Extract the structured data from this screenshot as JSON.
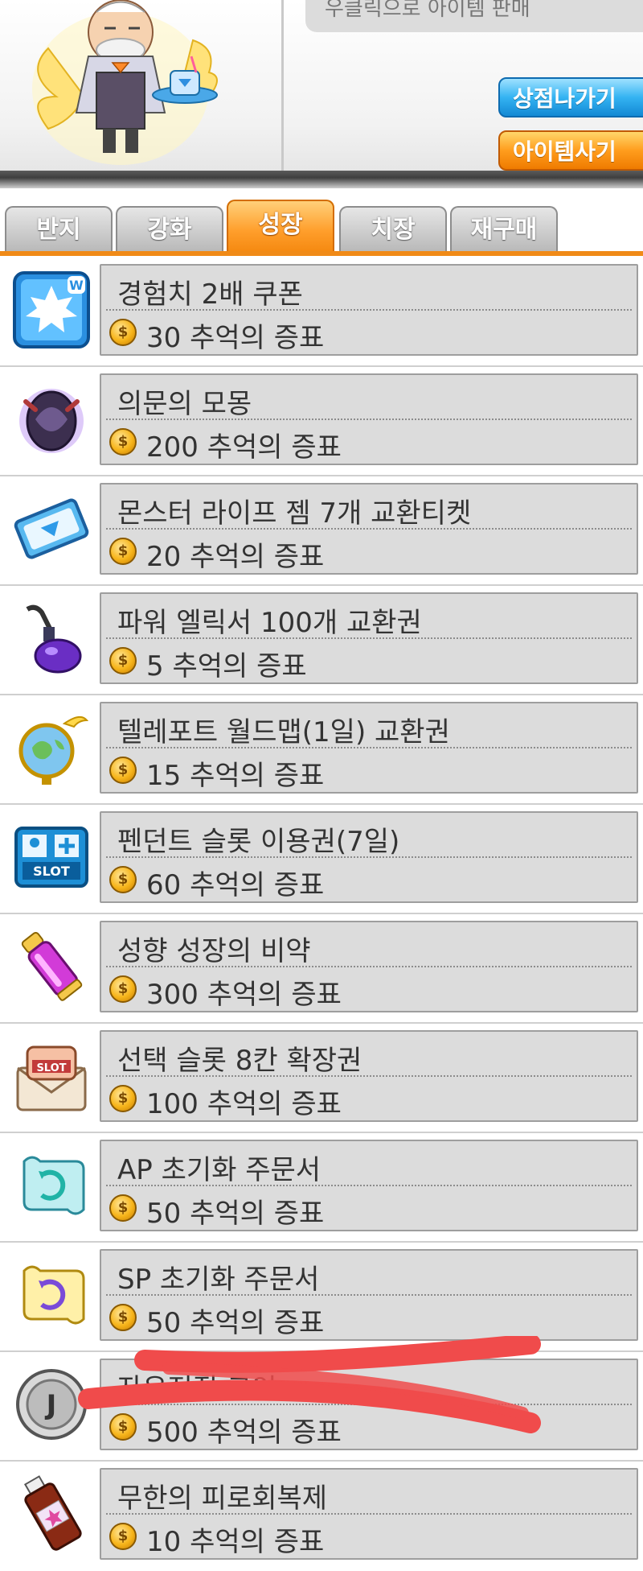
{
  "header": {
    "sell_strip_text": "우클릭으로 아이템 판매",
    "exit_button_label": "상점나가기",
    "buy_button_label": "아이템사기"
  },
  "tabs": [
    {
      "label": "반지",
      "active": false
    },
    {
      "label": "강화",
      "active": false
    },
    {
      "label": "성장",
      "active": true
    },
    {
      "label": "치장",
      "active": false
    },
    {
      "label": "재구매",
      "active": false
    }
  ],
  "currency_label": "추억의 증표",
  "items": [
    {
      "name": "경험치 2배 쿠폰",
      "price": "30",
      "icon": "exp-coupon-icon"
    },
    {
      "name": "의문의 모몽",
      "price": "200",
      "icon": "mystery-egg-icon"
    },
    {
      "name": "몬스터 라이프 젬 7개 교환티켓",
      "price": "20",
      "icon": "gem-ticket-icon"
    },
    {
      "name": "파워 엘릭서 100개 교환권",
      "price": "5",
      "icon": "elixir-potion-icon"
    },
    {
      "name": "텔레포트 월드맵(1일) 교환권",
      "price": "15",
      "icon": "teleport-globe-icon"
    },
    {
      "name": "펜던트 슬롯 이용권(7일)",
      "price": "60",
      "icon": "pendant-slot-icon"
    },
    {
      "name": "성향 성장의 비약",
      "price": "300",
      "icon": "trait-potion-icon"
    },
    {
      "name": "선택 슬롯 8칸 확장권",
      "price": "100",
      "icon": "slot-expansion-icon"
    },
    {
      "name": "AP 초기화 주문서",
      "price": "50",
      "icon": "ap-reset-scroll-icon"
    },
    {
      "name": "SP 초기화 주문서",
      "price": "50",
      "icon": "sp-reset-scroll-icon"
    },
    {
      "name": "자유전직 코인",
      "price": "500",
      "icon": "job-change-coin-icon"
    },
    {
      "name": "무한의 피로회복제",
      "price": "10",
      "icon": "fatigue-potion-icon"
    }
  ],
  "colors": {
    "accent_orange": "#f08a17",
    "accent_blue": "#1389d4",
    "panel_gray": "#dcdcdc",
    "scribble_red": "#f04b4b"
  }
}
